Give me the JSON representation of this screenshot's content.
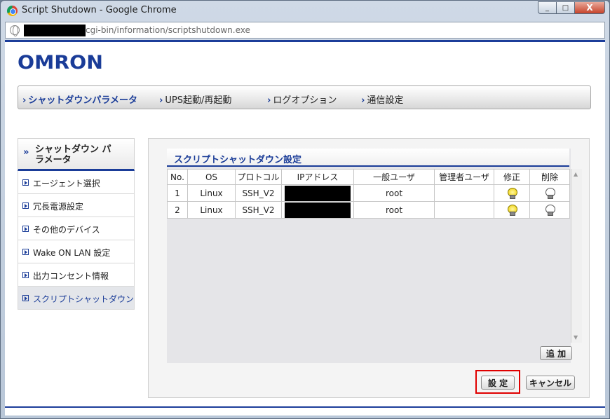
{
  "window": {
    "title": "Script Shutdown - Google Chrome",
    "url_path": "cgi-bin/information/scriptshutdown.exe",
    "controls": [
      "_",
      "□",
      "X"
    ]
  },
  "brand": {
    "logo": "OMRON",
    "color": "#1a3c98"
  },
  "topnav": {
    "items": [
      {
        "label": "シャットダウンパラメータ",
        "active": true
      },
      {
        "label": "UPS起動/再起動",
        "active": false
      },
      {
        "label": "ログオプション",
        "active": false
      },
      {
        "label": "通信設定",
        "active": false
      }
    ]
  },
  "sidebar": {
    "heading": "シャットダウン パラメータ",
    "items": [
      {
        "label": "エージェント選択"
      },
      {
        "label": "冗長電源設定"
      },
      {
        "label": "その他のデバイス"
      },
      {
        "label": "Wake ON LAN 設定"
      },
      {
        "label": "出力コンセント情報"
      },
      {
        "label": "スクリプトシャットダウン",
        "active": true
      }
    ]
  },
  "panel": {
    "title": "スクリプトシャットダウン設定",
    "columns": [
      "No.",
      "OS",
      "プロトコル",
      "IPアドレス",
      "一般ユーザ",
      "管理者ユーザ",
      "修正",
      "削除"
    ],
    "rows": [
      {
        "no": "1",
        "os": "Linux",
        "protocol": "SSH_V2",
        "user": "root",
        "admin": ""
      },
      {
        "no": "2",
        "os": "Linux",
        "protocol": "SSH_V2",
        "user": "root",
        "admin": ""
      }
    ],
    "add_label": "追 加",
    "save_label": "設 定",
    "cancel_label": "キャンセル"
  }
}
